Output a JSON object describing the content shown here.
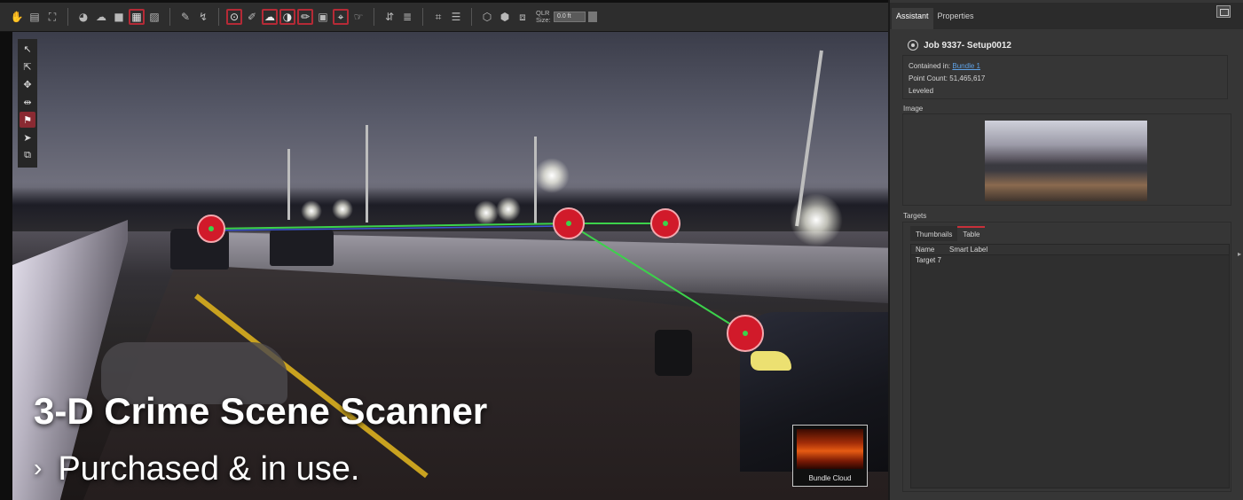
{
  "toolbar": {
    "icons": [
      "hand-icon",
      "pan-icon",
      "zoom-region-icon",
      "scan-icon",
      "cloud-icon",
      "square-icon",
      "grid-icon",
      "image-icon",
      "measure-icon",
      "pointer-icon",
      "target-icon",
      "tag-icon",
      "cloud-target-icon",
      "sphere-icon",
      "pencil-icon",
      "camera-icon",
      "pin-icon",
      "hand-point-icon",
      "axis-icon",
      "stack-icon",
      "register-icon",
      "menu-icon",
      "box-icon",
      "box-split-icon",
      "box-qlr-icon"
    ],
    "qlr_label": "QLR Size:",
    "qlr_value": "0.0 ft"
  },
  "left_tools": [
    "select-arrow-icon",
    "select-add-icon",
    "move-icon",
    "fit-icon",
    "target-person-icon",
    "navigate-icon",
    "cube-icon"
  ],
  "overlay": {
    "headline": "3-D Crime Scene Scanner",
    "chevron": "›",
    "subline": "Purchased & in use."
  },
  "bundle_thumb": {
    "label": "Bundle Cloud"
  },
  "panel": {
    "tabs": [
      "Assistant",
      "Properties"
    ],
    "job_title": "Job 9337- Setup0012",
    "contained_label": "Contained in:",
    "contained_link": "Bundle 1",
    "point_count_label": "Point Count:",
    "point_count_value": "51,465,617",
    "leveled": "Leveled",
    "image_section": "Image",
    "targets_section": "Targets",
    "target_tabs": [
      "Thumbnails",
      "Table"
    ],
    "table_columns": [
      "Name",
      "Smart Label"
    ],
    "table_rows": [
      [
        "Target 7",
        ""
      ]
    ]
  }
}
